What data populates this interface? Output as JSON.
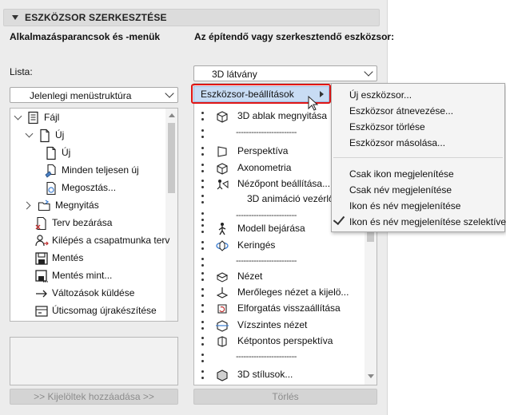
{
  "panel": {
    "title": "ESZKÖZSOR SZERKESZTÉSE",
    "left_heading": "Alkalmazásparancsok és -menük",
    "right_heading": "Az építendő vagy szerkesztendő eszközsor:",
    "list_label": "Lista:",
    "list_dropdown_value": "Jelenlegi menüstruktúra",
    "toolbar_dropdown_value": "3D látvány",
    "add_button": ">> Kijelöltek hozzáadása >>",
    "delete_button": "Törlés"
  },
  "left_tree": [
    {
      "label": "Fájl",
      "icon": "document-icon",
      "expander": "open"
    },
    {
      "label": "Új",
      "icon": "new-file-icon",
      "expander": "open"
    },
    {
      "label": "Új",
      "icon": "new-file-icon",
      "expander": ""
    },
    {
      "label": "Minden teljesen új",
      "icon": "reset-new-icon",
      "expander": ""
    },
    {
      "label": "Megosztás...",
      "icon": "share-icon",
      "expander": ""
    },
    {
      "label": "Megnyitás",
      "icon": "open-folder-icon",
      "expander": "closed"
    },
    {
      "label": "Terv bezárása",
      "icon": "close-plan-icon",
      "expander": ""
    },
    {
      "label": "Kilépés a csapatmunka terv",
      "icon": "teamwork-leave-icon",
      "expander": ""
    },
    {
      "label": "Mentés",
      "icon": "save-icon",
      "expander": ""
    },
    {
      "label": "Mentés mint...",
      "icon": "save-as-icon",
      "expander": ""
    },
    {
      "label": "Változások küldése",
      "icon": "send-changes-icon",
      "expander": ""
    },
    {
      "label": "Úticsomag újrakészítése",
      "icon": "package-icon",
      "expander": ""
    }
  ],
  "right_list": [
    {
      "label": "3D ablak megnyitása",
      "icon": "cube-icon"
    },
    {
      "label": "------------------------",
      "icon": ""
    },
    {
      "label": "Perspektíva",
      "icon": "perspective-icon"
    },
    {
      "label": "Axonometria",
      "icon": "axonometry-icon"
    },
    {
      "label": "Nézőpont beállítása...",
      "icon": "viewpoint-icon"
    },
    {
      "label": "3D animáció vezérlői",
      "icon": ""
    },
    {
      "label": "------------------------",
      "icon": ""
    },
    {
      "label": "Modell bejárása",
      "icon": "walk-icon"
    },
    {
      "label": "Keringés",
      "icon": "orbit-icon"
    },
    {
      "label": "------------------------",
      "icon": ""
    },
    {
      "label": "Nézet",
      "icon": "view-icon"
    },
    {
      "label": "Merőleges nézet a kijelö...",
      "icon": "perpendicular-view-icon"
    },
    {
      "label": "Elforgatás visszaállítása",
      "icon": "reset-rotation-icon"
    },
    {
      "label": "Vízszintes nézet",
      "icon": "horizontal-view-icon"
    },
    {
      "label": "Kétpontos perspektíva",
      "icon": "two-point-perspective-icon"
    },
    {
      "label": "------------------------",
      "icon": ""
    },
    {
      "label": "3D stílusok...",
      "icon": "styles-icon"
    }
  ],
  "highlighted_item": "Eszközsor-beállítások",
  "context_menu": {
    "items_top": [
      "Új eszközsor...",
      "Eszközsor átnevezése...",
      "Eszközsor törlése",
      "Eszközsor másolása..."
    ],
    "items_bottom": [
      "Csak ikon megjelenítése",
      "Csak név megjelenítése",
      "Ikon és név megjelenítése",
      "Ikon és név megjelenítése szelektíven"
    ],
    "checked_item": "Ikon és név megjelenítése szelektíven"
  },
  "colors": {
    "highlight": "#c8dcf4",
    "callout_border": "#e01616",
    "panel_bg": "#ececec"
  }
}
